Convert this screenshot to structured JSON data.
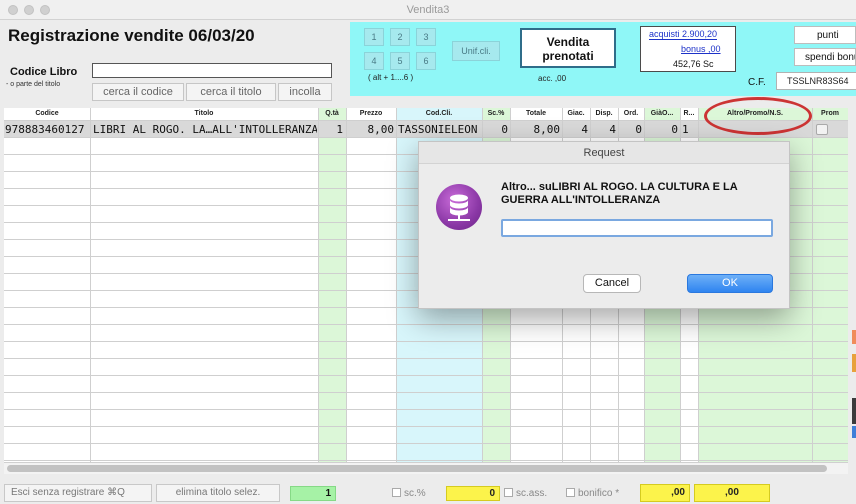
{
  "window": {
    "title": "Vendita3"
  },
  "header": {
    "title": "Registrazione vendite  06/03/20",
    "codice_label": "Codice Libro",
    "codice_hint": "- o parte del  titolo",
    "codice_value": "",
    "buttons": {
      "cerca_codice": "cerca il codice",
      "cerca_titolo": "cerca il titolo",
      "incolla": "incolla"
    }
  },
  "panel": {
    "keys": [
      "1",
      "2",
      "3",
      "4",
      "5",
      "6"
    ],
    "keys_hint": "( alt + 1....6 )",
    "unif": "Unif.cli.",
    "vendita_prenotati": "Vendita prenotati",
    "acc": "acc. ,00",
    "acquisti": "acquisti 2.900,20",
    "bonus": "bonus ,00",
    "sc": "452,76  Sc",
    "cf_label": "C.F.",
    "cf_value": "TSSLNR83S64",
    "punti": "punti",
    "spendi_bonus": "spendi bonus"
  },
  "table": {
    "columns": [
      "Codice",
      "Titolo",
      "Q.tà",
      "Prezzo",
      "Cod.Cli.",
      "Sc.%",
      "Totale",
      "Giac.",
      "Disp.",
      "Ord.",
      "GiàO...",
      "R...",
      "Altro/Promo/N.S.",
      "Prom"
    ],
    "rows": [
      {
        "codice": "978883460127",
        "titolo": "LIBRI AL ROGO. LA…ALL'INTOLLERANZA",
        "qta": "1",
        "prezzo": "8,00",
        "codcli": "TASSONIELEON",
        "sc": "0",
        "totale": "8,00",
        "giac": "4",
        "disp": "4",
        "ord": "0",
        "giao": "0",
        "r": "1",
        "altro": "",
        "prom": ""
      }
    ]
  },
  "footer": {
    "esci": "Esci senza registrare  ⌘Q",
    "elimina": "elimina titolo selez.",
    "count": "1",
    "scperc": "sc.%",
    "scperc_val": "0",
    "scass": "sc.ass.",
    "bonifico": "bonifico *",
    "val1": ",00",
    "val2": ",00"
  },
  "dialog": {
    "title": "Request",
    "message": "Altro... suLIBRI AL ROGO. LA CULTURA E LA GUERRA ALL'INTOLLERANZA",
    "input_value": "",
    "cancel": "Cancel",
    "ok": "OK"
  },
  "colors": {
    "accent_cyan": "#8ff7f7",
    "highlight_red": "#cc3434",
    "yellow": "#fcf34b",
    "ok_blue": "#2f84f0"
  }
}
